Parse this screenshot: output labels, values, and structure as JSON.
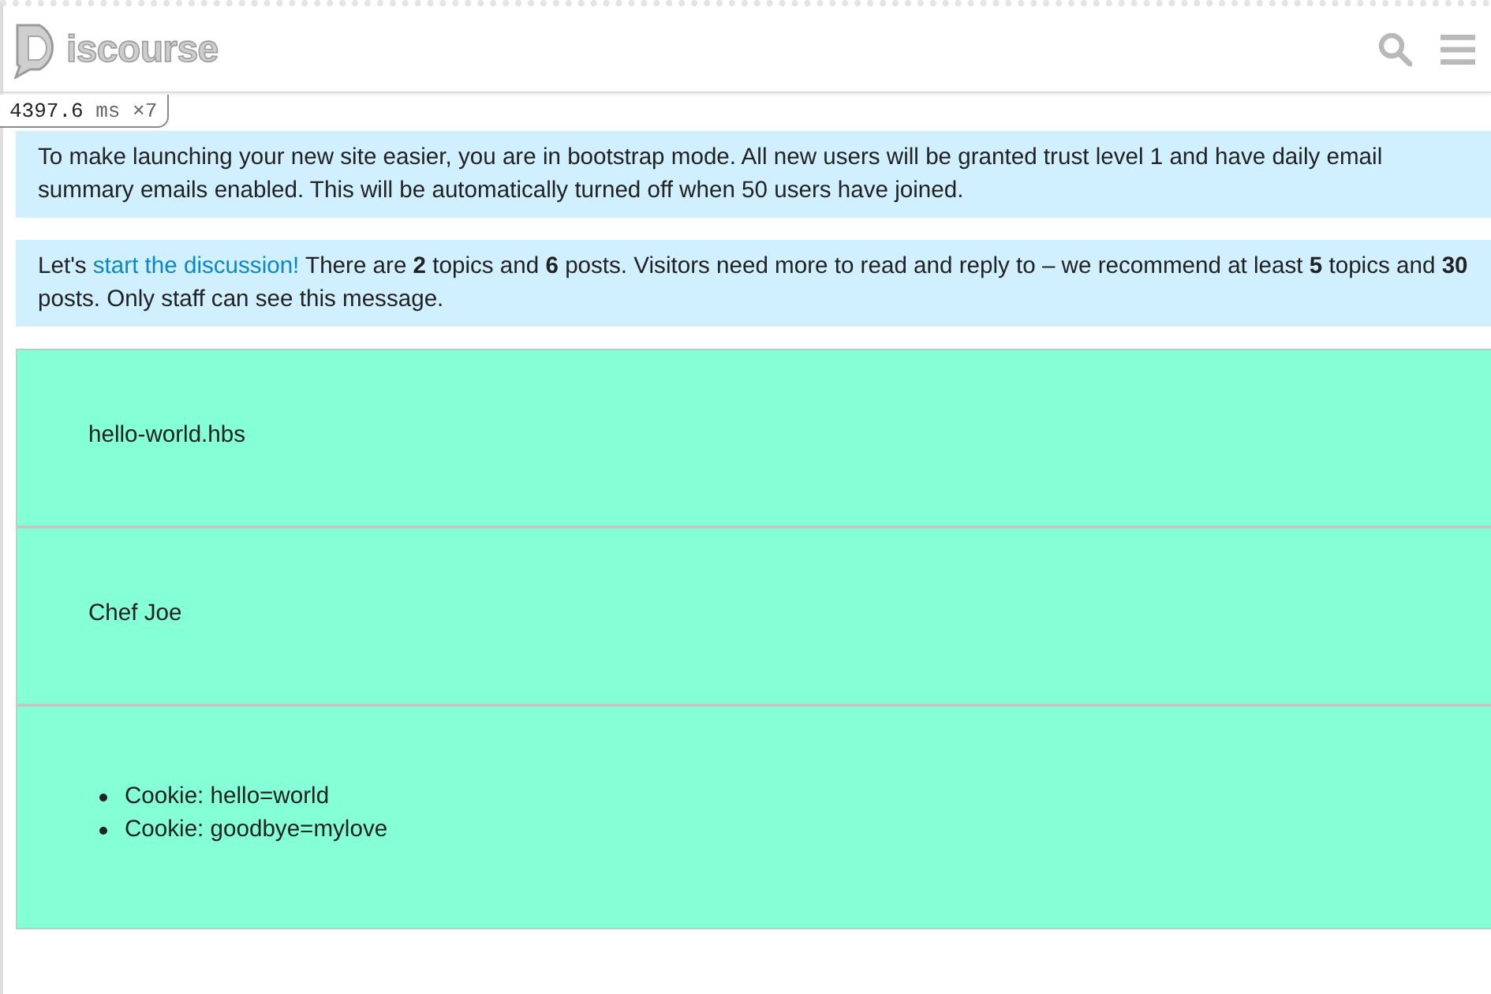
{
  "header": {
    "logo": {
      "text": "iscourse"
    },
    "actions": [
      {
        "kind": "search"
      },
      {
        "kind": "menu"
      }
    ]
  },
  "profiler": {
    "time": "4397.6",
    "unit": "ms",
    "count": "×7"
  },
  "notices": [
    {
      "kind": "plain",
      "text": "To make launching your new site easier, you are in bootstrap mode. All new users will be granted trust level 1 and have daily email summary emails enabled. This will be automatically turned off when 50 users have joined."
    },
    {
      "kind": "link",
      "before": "Let's",
      "link": "start the discussion!",
      "after": "There are **2** topics and **6** posts. Visitors need more to read and reply to – we recommend at least **5** topics and **30** posts. Only staff can see this message."
    }
  ],
  "panels": [
    {
      "kind": "text",
      "text": "hello-world.hbs"
    },
    {
      "kind": "text",
      "text": "Chef Joe"
    },
    {
      "kind": "list",
      "items": [
        "Cookie: hello=world",
        "Cookie: goodbye=mylove"
      ]
    }
  ]
}
